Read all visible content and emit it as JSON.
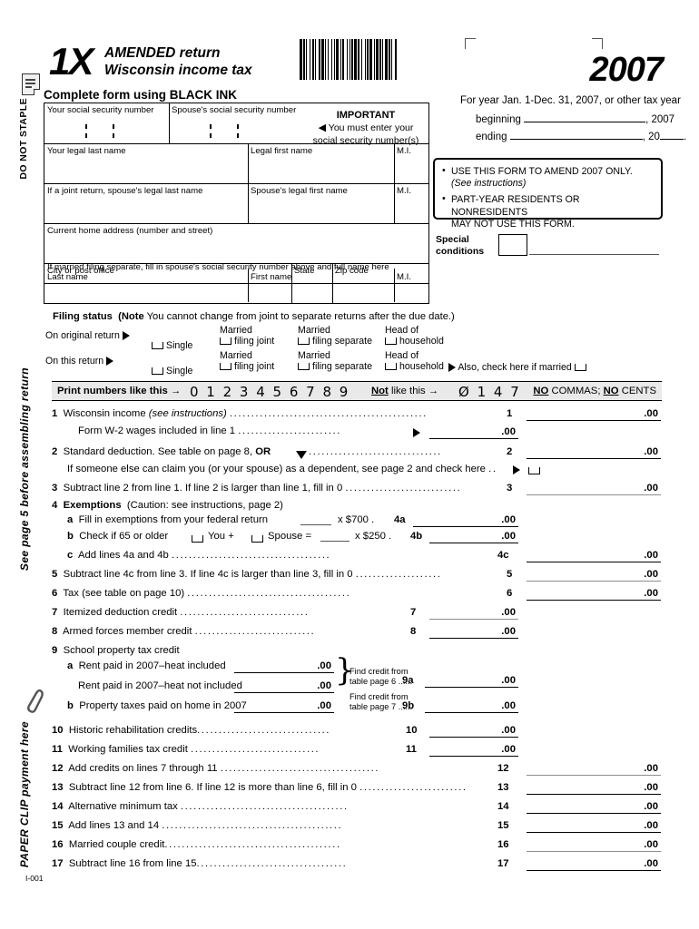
{
  "margin": {
    "do_not_staple": "DO NOT STAPLE",
    "assembling": "See page 5 before assembling return",
    "paper_clip": "PAPER CLIP payment here",
    "page_icon": "document-icon",
    "clip_icon": "paperclip-icon"
  },
  "header": {
    "form_number": "1X",
    "title_line1": "AMENDED return",
    "title_line2": "Wisconsin income tax",
    "complete_ink": "Complete form using BLACK INK",
    "year": "2007",
    "fiscal_year_note": "For year Jan. 1-Dec. 31, 2007, or other tax year",
    "beginning_label": "beginning",
    "beginning_suffix": ", 2007",
    "ending_label": "ending",
    "ending_suffix": ", 20",
    "ending_period": ".",
    "barcode_icon": "barcode"
  },
  "ssn": {
    "your_label": "Your social security number",
    "spouse_label": "Spouse's social security number"
  },
  "important": {
    "heading": "IMPORTANT",
    "line1": "You must enter your",
    "line2": "social security number(s)",
    "arrow_icon": "left-triangle-icon"
  },
  "address": {
    "your_last_name": "Your legal last name",
    "legal_first_name": "Legal first name",
    "mi1": "M.I.",
    "spouse_last_name": "If a joint return, spouse's legal last name",
    "spouse_first_name": "Spouse's legal first name",
    "mi2": "M.I.",
    "home_address": "Current home address (number and street)",
    "city": "City or post office",
    "state": "State",
    "zip": "Zip code",
    "separate_note": "If married filing separate, fill in spouse's social security number above and full name here",
    "last_name": "Last name",
    "first_name": "First name",
    "mi3": "M.I."
  },
  "notice": {
    "item1_line1": "USE THIS FORM TO AMEND 2007 ONLY.",
    "item1_line2": "(See instructions)",
    "item2_line1": "PART-YEAR RESIDENTS OR NONRESIDENTS",
    "item2_line2": "MAY NOT USE THIS FORM."
  },
  "special_conditions": {
    "label_line1": "Special",
    "label_line2": "conditions"
  },
  "filing_status": {
    "heading": "Filing status",
    "note_bold": "(Note",
    "note_text": "You cannot change from joint to separate returns after the due date.)",
    "original_label": "On original return",
    "this_label": "On this return",
    "options": [
      {
        "line1": "",
        "line2": "Single"
      },
      {
        "line1": "Married",
        "line2": "filing joint"
      },
      {
        "line1": "Married",
        "line2": "filing separate"
      },
      {
        "line1": "Head of",
        "line2": "household"
      }
    ],
    "also_check": "Also, check here if married"
  },
  "print_bar": {
    "label": "Print numbers like this",
    "arrow": "→",
    "good_digits": "0 1 2 3 4 5 6 7 8 9",
    "not_word": "Not",
    "not_rest": "like this",
    "bad_digits": "Ø 1 4 7",
    "no_commas": "NO COMMAS;  NO CENTS",
    "no_word1": "NO",
    "no_word2": "NO",
    "commas_word": "COMMAS;",
    "cents_word": "CENTS"
  },
  "lines": [
    {
      "no": "1",
      "text": "Wisconsin income",
      "italic": "(see instructions)",
      "ref": "1",
      "cents": ".00"
    },
    {
      "no": "",
      "text": "Form W-2 wages included in line 1",
      "ref": "",
      "cents": ".00"
    },
    {
      "no": "2",
      "text": "Standard deduction. See table on page 8,",
      "bold_tail": "OR",
      "ref": "2",
      "cents": ".00"
    },
    {
      "no": "",
      "text": "If someone else can claim you (or your spouse) as a dependent, see page 2 and check here",
      "ref": "",
      "cents": ""
    },
    {
      "no": "3",
      "text": "Subtract line 2 from line 1. If line 2 is larger than line 1, fill in 0",
      "ref": "3",
      "cents": ".00"
    },
    {
      "no": "4",
      "text": "Exemptions",
      "italic": "(Caution:  see instructions, page 2)",
      "ref": "",
      "cents": ""
    },
    {
      "no": "a",
      "text": "Fill in exemptions from your federal return",
      "mult": "x  $700 .",
      "ref": "4a",
      "cents": ".00"
    },
    {
      "no": "b",
      "text": "Check if 65 or older",
      "you": "You +",
      "spouse": "Spouse  =",
      "mult": "x  $250 .",
      "ref": "4b",
      "cents": ".00"
    },
    {
      "no": "c",
      "text": "Add lines 4a and 4b",
      "ref": "4c",
      "cents": ".00"
    },
    {
      "no": "5",
      "text": "Subtract line 4c from line 3. If line 4c is larger than line 3, fill in 0",
      "ref": "5",
      "cents": ".00"
    },
    {
      "no": "6",
      "text": "Tax (see table on page 10)",
      "ref": "6",
      "cents": ".00"
    },
    {
      "no": "7",
      "text": "Itemized deduction credit",
      "ref": "7",
      "cents": ".00"
    },
    {
      "no": "8",
      "text": "Armed forces member credit",
      "ref": "8",
      "cents": ".00"
    },
    {
      "no": "9",
      "text": "School property tax credit",
      "ref": "",
      "cents": ""
    },
    {
      "no": "a",
      "text": "Rent paid in 2007–heat included",
      "ref": "9a",
      "cents": ".00"
    },
    {
      "no": "",
      "text": "Rent paid in 2007–heat not included",
      "ref": "",
      "cents": ".00"
    },
    {
      "no": "b",
      "text": "Property taxes paid on home in 2007",
      "ref": "9b",
      "cents": ".00"
    },
    {
      "no": "10",
      "text": "Historic rehabilitation credits",
      "ref": "10",
      "cents": ".00"
    },
    {
      "no": "11",
      "text": "Working families tax credit",
      "ref": "11",
      "cents": ".00"
    },
    {
      "no": "12",
      "text": "Add credits on lines 7 through 11",
      "ref": "12",
      "cents": ".00"
    },
    {
      "no": "13",
      "text": "Subtract line 12 from line 6. If line 12 is more than line 6, fill in 0",
      "ref": "13",
      "cents": ".00"
    },
    {
      "no": "14",
      "text": "Alternative minimum tax",
      "ref": "14",
      "cents": ".00"
    },
    {
      "no": "15",
      "text": "Add lines 13 and 14",
      "ref": "15",
      "cents": ".00"
    },
    {
      "no": "16",
      "text": "Married couple credit",
      "ref": "16",
      "cents": ".00"
    },
    {
      "no": "17",
      "text": "Subtract line 16 from line 15",
      "ref": "17",
      "cents": ".00"
    }
  ],
  "school_credit": {
    "find_credit_9a_l1": "Find credit from",
    "find_credit_9a_l2": "table page 6 ......",
    "find_credit_9b_l1": "Find credit from",
    "find_credit_9b_l2": "table page 7 ......"
  },
  "footer": {
    "code": "I-001"
  }
}
